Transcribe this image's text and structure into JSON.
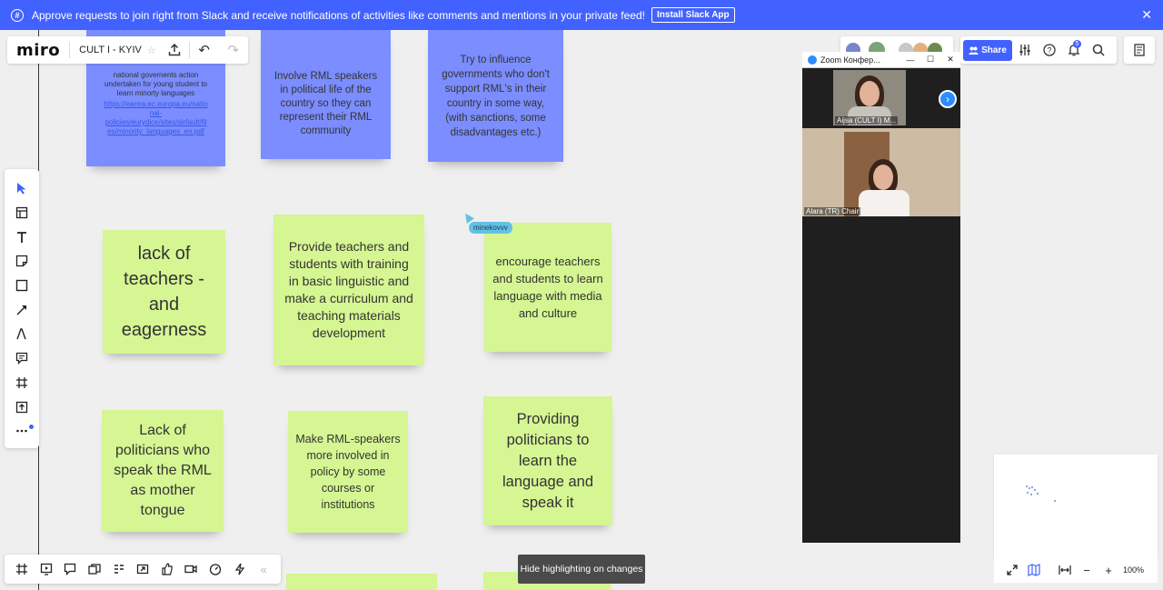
{
  "banner": {
    "message": "Approve requests to join right from Slack and receive notifications of activities like comments and mentions in your private feed!",
    "button": "Install Slack App",
    "close": "✕"
  },
  "board": {
    "logo": "miro",
    "name": "CULT I - KYIV"
  },
  "stickies": {
    "s1": {
      "text": "national governents action\nundertaken for young student to\nlearn minorty languages",
      "link": "https://eacea.ec.europa.eu/natio\nnal-\npolicies/eurydice/sites/default/fil\nes/minority_languages_en.pdf"
    },
    "s2": "Involve RML speakers in political life of the country so they can represent their RML community",
    "s3": "Try to influence governments who don't support RML's in their country in some way, (with sanctions, some disadvantages etc.)",
    "s4": "lack of teachers - and eagerness",
    "s5": "Provide teachers and students with training in basic linguistic and make  a  curriculum and teaching materials development",
    "s6": "encourage teachers and students to learn language with media and culture",
    "s7": "Lack of politicians who speak the RML as mother tongue",
    "s8": "Make RML-speakers more involved in policy by some courses or institutions",
    "s9": "Providing politicians to learn the language and speak it"
  },
  "cursor": {
    "user": "minekovvv",
    "color": "#63c1e6"
  },
  "toolbar_right": {
    "share": "Share",
    "notifications_count": "5"
  },
  "zoom": {
    "title": "Zoom Конфер...",
    "participant1": "Aijsa (CULT I) M...",
    "participant2": "Alara (TR) Chair"
  },
  "tooltip": "Hide highlighting on changes",
  "zoom_level": "100%",
  "icons": {
    "slack": "slack-icon",
    "upload": "upload-icon",
    "undo": "undo-icon",
    "redo": "redo-icon"
  }
}
